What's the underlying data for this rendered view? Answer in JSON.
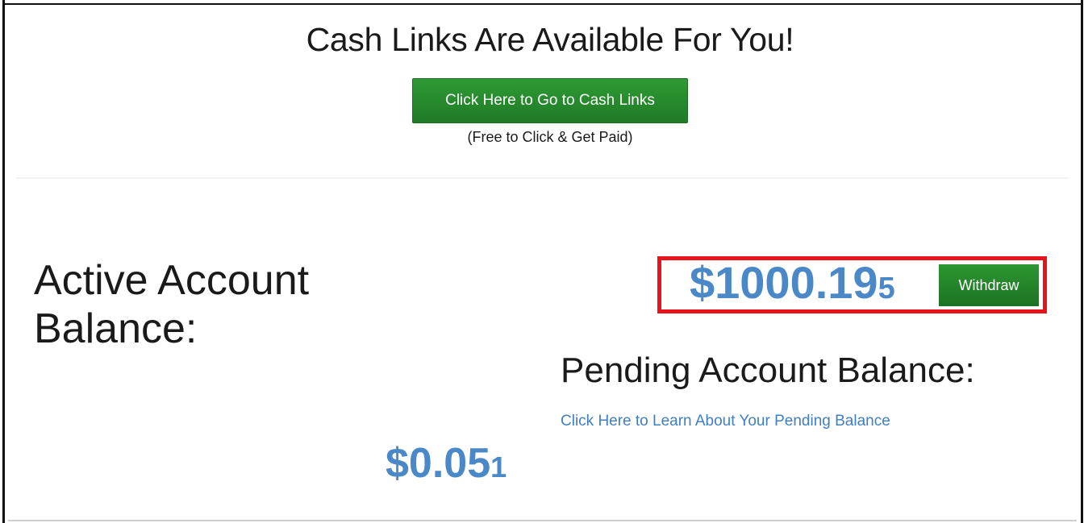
{
  "header": {
    "title": "Cash Links Are Available For You!",
    "cash_links_button": "Click Here to Go to Cash Links",
    "note": "(Free to Click & Get Paid)"
  },
  "active_balance": {
    "label": "Active Account Balance:",
    "amount_main": "$0.05",
    "amount_extra_digit": "1"
  },
  "pending_balance": {
    "amount_main": "$1000.19",
    "amount_extra_digit": "5",
    "withdraw_button": "Withdraw",
    "label": "Pending Account Balance:",
    "info_link": "Click Here to Learn About Your Pending Balance"
  },
  "colors": {
    "button_green": "#1f7a25",
    "amount_blue": "#4a88c7",
    "link_blue": "#3f7fc2",
    "highlight_red": "#e8131b"
  }
}
